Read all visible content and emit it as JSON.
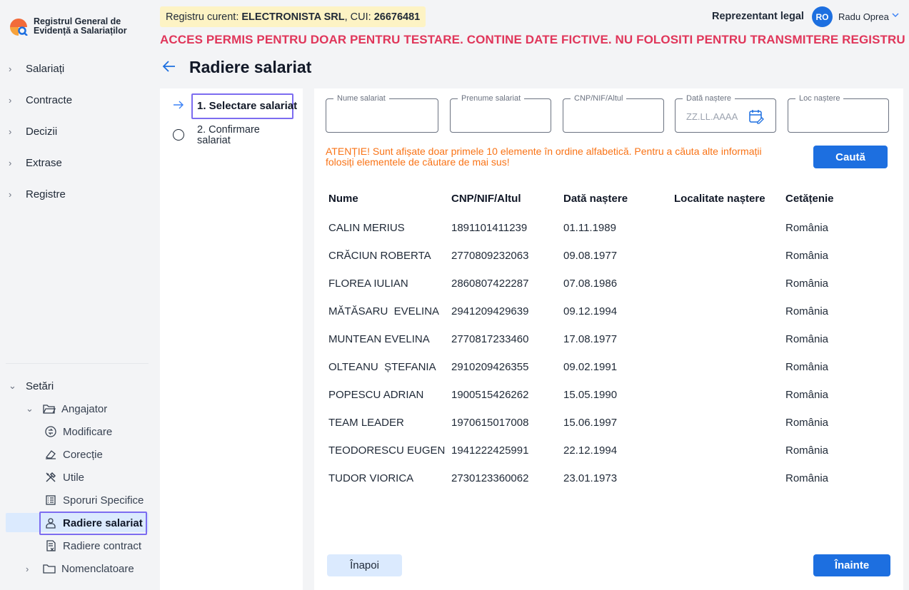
{
  "app": {
    "logo_text": "Registrul General de Evidență a Salariaților"
  },
  "sidebar": {
    "items": [
      {
        "label": "Salariați"
      },
      {
        "label": "Contracte"
      },
      {
        "label": "Decizii"
      },
      {
        "label": "Extrase"
      },
      {
        "label": "Registre"
      }
    ],
    "settings": {
      "label": "Setări",
      "employer": {
        "label": "Angajator",
        "children": [
          {
            "label": "Modificare",
            "icon": "circle-arrows-icon"
          },
          {
            "label": "Corecție",
            "icon": "eraser-icon"
          },
          {
            "label": "Utile",
            "icon": "tools-icon"
          },
          {
            "label": "Sporuri Specifice",
            "icon": "list-icon"
          },
          {
            "label": "Radiere salariat",
            "icon": "user-icon",
            "active": true
          },
          {
            "label": "Radiere contract",
            "icon": "document-x-icon"
          }
        ]
      },
      "nomenclatures": {
        "label": "Nomenclatoare"
      }
    }
  },
  "header": {
    "registry_prefix": "Registru curent: ",
    "registry_company": "ELECTRONISTA SRL",
    "registry_cui_prefix": ", CUI: ",
    "registry_cui": "26676481",
    "role": "Reprezentant legal",
    "avatar_initials": "RO",
    "user_name": "Radu Oprea",
    "warning": "ACCES PERMIS PENTRU DOAR PENTRU TESTARE. CONTINE DATE FICTIVE. NU FOLOSITI PENTRU TRANSMITERE REGISTRU"
  },
  "page": {
    "title": "Radiere salariat"
  },
  "steps": [
    {
      "label": "1. Selectare salariat",
      "active": true
    },
    {
      "label": "2. Confirmare salariat",
      "active": false
    }
  ],
  "search": {
    "fields": [
      {
        "label": "Nume salariat",
        "value": ""
      },
      {
        "label": "Prenume salariat",
        "value": ""
      },
      {
        "label": "CNP/NIF/Altul",
        "value": ""
      },
      {
        "label": "Dată naștere",
        "placeholder": "ZZ.LL.AAAA"
      },
      {
        "label": "Loc naștere",
        "value": ""
      }
    ],
    "notice": "ATENȚIE! Sunt afișate doar primele 10 elemente în ordine alfabetică. Pentru a căuta alte informații folosiți elementele de căutare de mai sus!",
    "button_label": "Caută"
  },
  "table": {
    "headers": [
      "Nume",
      "CNP/NIF/Altul",
      "Dată naștere",
      "Localitate naștere",
      "Cetățenie"
    ],
    "rows": [
      [
        "CALIN MERIUS",
        "1891101411239",
        "01.11.1989",
        "",
        "România"
      ],
      [
        "CRĂCIUN ROBERTA",
        "2770809232063",
        "09.08.1977",
        "",
        "România"
      ],
      [
        "FLOREA IULIAN",
        "2860807422287",
        "07.08.1986",
        "",
        "România"
      ],
      [
        "MĂTĂSARU  EVELINA",
        "2941209429639",
        "09.12.1994",
        "",
        "România"
      ],
      [
        "MUNTEAN EVELINA",
        "2770817233460",
        "17.08.1977",
        "",
        "România"
      ],
      [
        "OLTEANU  ȘTEFANIA",
        "2910209426355",
        "09.02.1991",
        "",
        "România"
      ],
      [
        "POPESCU ADRIAN",
        "1900515426262",
        "15.05.1990",
        "",
        "România"
      ],
      [
        "TEAM LEADER",
        "1970615017008",
        "15.06.1997",
        "",
        "România"
      ],
      [
        "TEODORESCU EUGEN",
        "1941222425991",
        "22.12.1994",
        "",
        "România"
      ],
      [
        "TUDOR VIORICA",
        "2730123360062",
        "23.01.1973",
        "",
        "România"
      ]
    ]
  },
  "footer": {
    "back_label": "Înapoi",
    "next_label": "Înainte"
  },
  "colors": {
    "accent": "#1d6fe0",
    "warning": "#e0365a",
    "notice": "#f97316",
    "focus": "#7c6cf0"
  }
}
